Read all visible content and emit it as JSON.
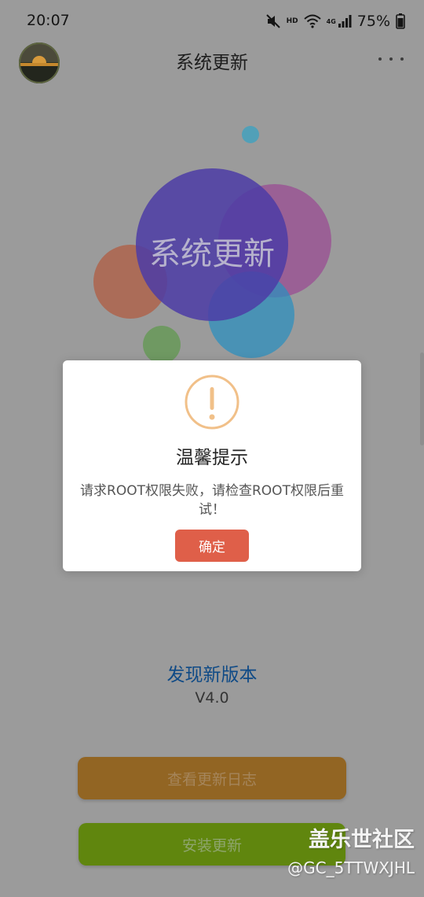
{
  "status_bar": {
    "time": "20:07",
    "network": "4G",
    "hd": "HD",
    "battery": "75%"
  },
  "header": {
    "title": "系统更新",
    "avatar": "avatar-sunset",
    "menu_icon": "more-icon"
  },
  "hero": {
    "text": "系统更新",
    "colors": [
      "#b25a3e",
      "#5e994c",
      "#35a2c4",
      "#9a4f94",
      "#2a8fbf",
      "#4c3ca6"
    ]
  },
  "dialog": {
    "icon": "warning-circle-icon",
    "icon_color": "#f1c089",
    "title": "温馨提示",
    "message": "请求ROOT权限失败，请检查ROOT权限后重试！",
    "confirm_label": "确定",
    "confirm_color": "#df5f49"
  },
  "update": {
    "status_text": "发现新版本",
    "version": "V4.0",
    "view_log_label": "查看更新日志",
    "install_label": "安装更新"
  },
  "watermark": {
    "title": "盖乐世社区",
    "handle": "@GC_5TTWXJHL"
  }
}
